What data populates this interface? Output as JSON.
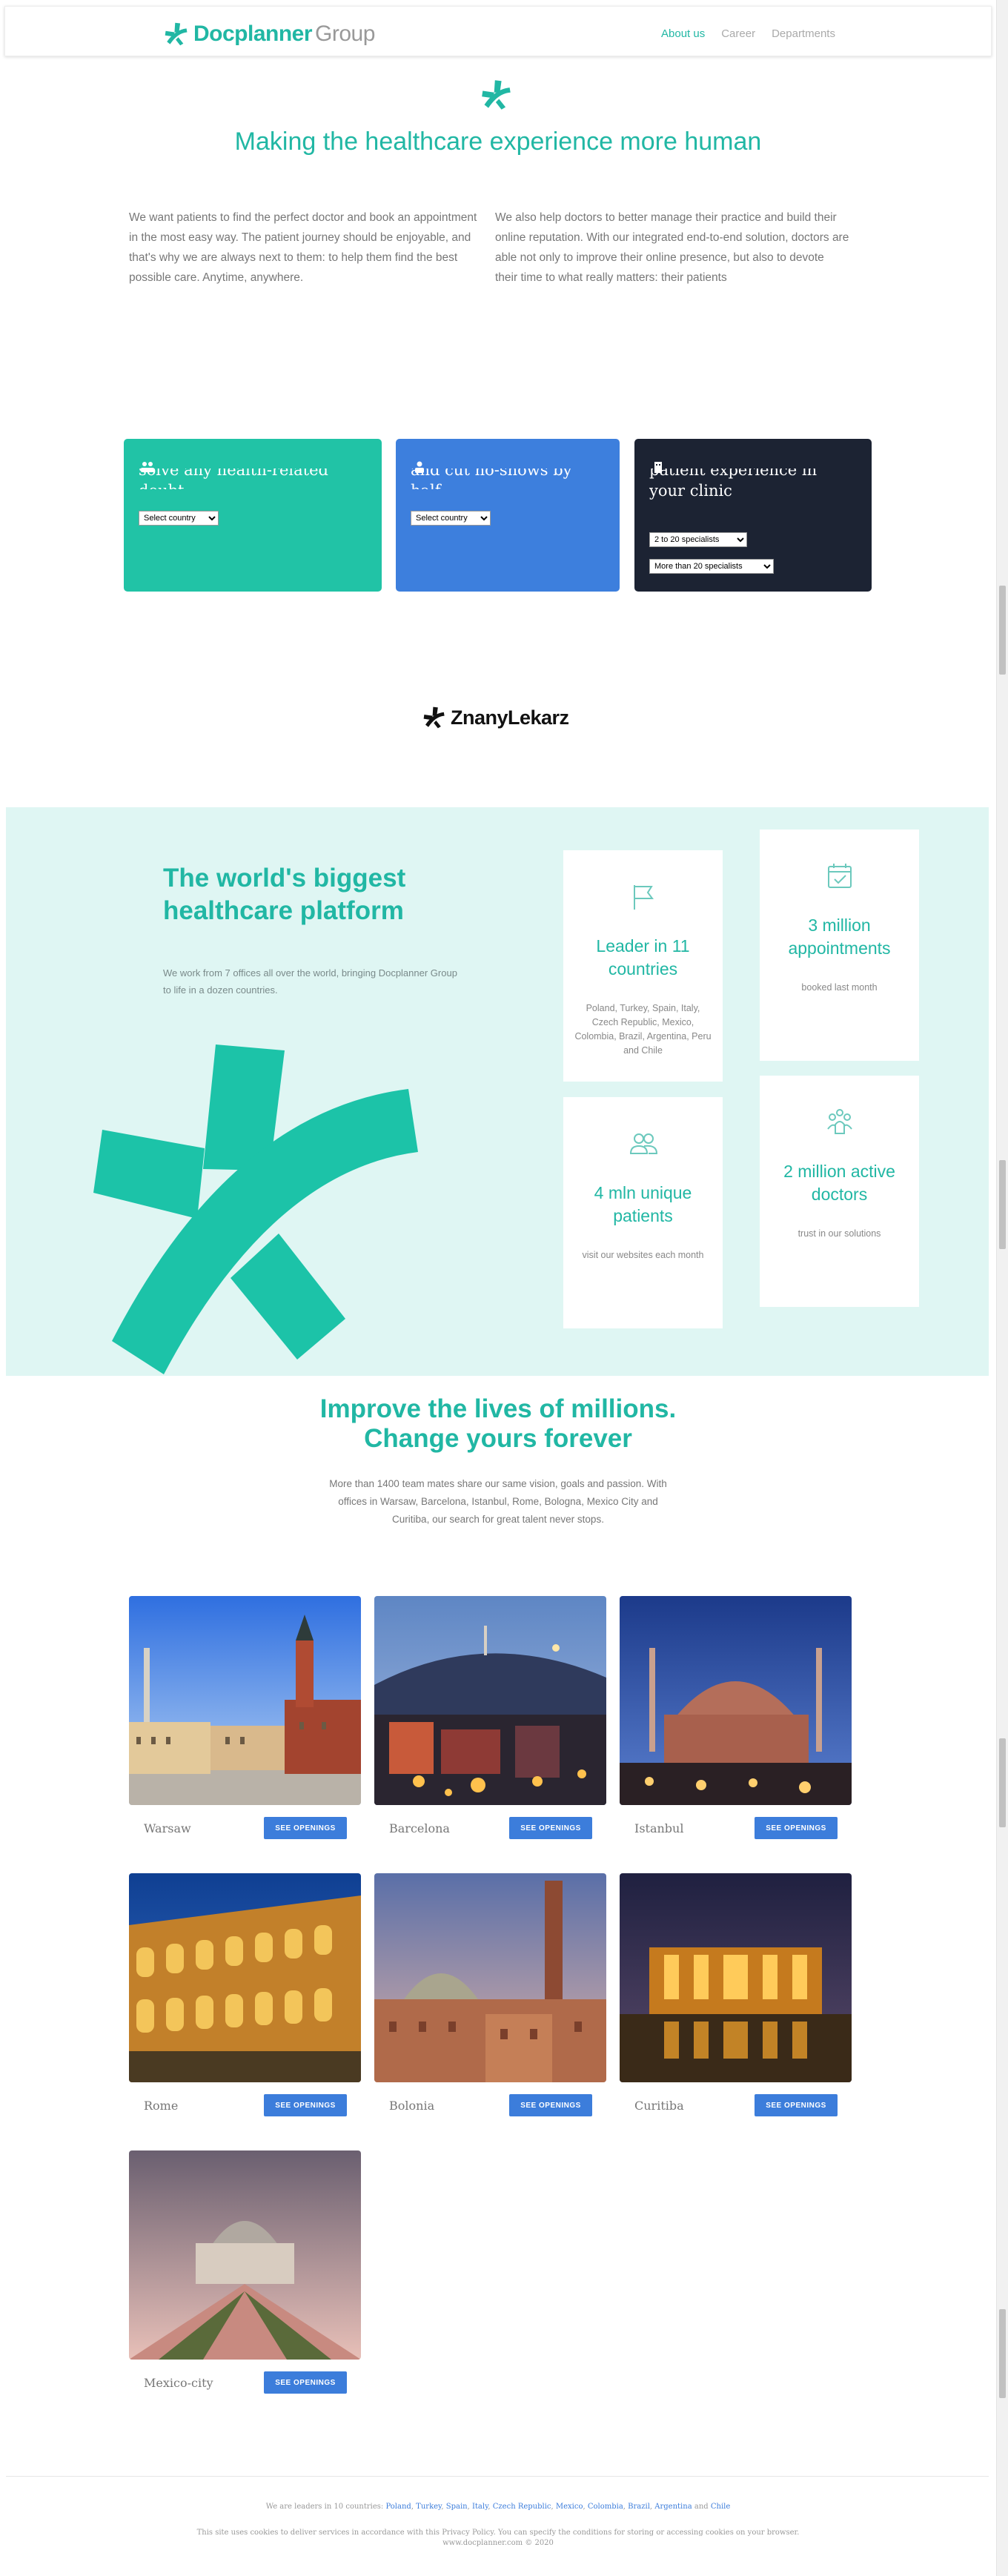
{
  "header": {
    "logo_brand": "Docplanner",
    "logo_suffix": "Group",
    "nav": [
      {
        "label": "About us",
        "active": true
      },
      {
        "label": "Career",
        "active": false
      },
      {
        "label": "Departments",
        "active": false
      }
    ]
  },
  "hero": {
    "title": "Making the healthcare experience more human",
    "left_text": "We want patients to find the perfect doctor and book an appointment in the most easy way. The patient journey should be enjoyable, and that's why we are always next to them: to help them find the best possible care. Anytime, anywhere.",
    "right_text": "We also help doctors to better manage their practice and build their online reputation. With our integrated end-to-end solution, doctors are able not only to improve their online presence, but also to devote their time to what really matters: their patients"
  },
  "cards": [
    {
      "text": "solve any health-related doubt",
      "color": "#21c3a6",
      "select": "Select country"
    },
    {
      "text": "and cut no-shows by half",
      "color": "#3d7fdd",
      "select": "Select country"
    },
    {
      "text": "patient experience in your clinic",
      "color": "#1c2333",
      "select": "2 to 20 specialists",
      "select2": "More than 20 specialists"
    }
  ],
  "partner_logo": "ZnanyLekarz",
  "stats": {
    "title": "The world's biggest healthcare platform",
    "subtitle": "We work from 7 offices all over the world, bringing Docplanner Group to life in a dozen countries.",
    "items": [
      {
        "icon": "flag-icon",
        "value": "Leader in 11 countries",
        "desc": "Poland, Turkey, Spain, Italy, Czech Republic, Mexico, Colombia, Brazil, Argentina, Peru and Chile"
      },
      {
        "icon": "calendar-check-icon",
        "value": "3 million appointments",
        "desc": "booked last month"
      },
      {
        "icon": "users-icon",
        "value": "4 mln unique patients",
        "desc": "visit our websites each month"
      },
      {
        "icon": "doctors-icon",
        "value": "2 million active doctors",
        "desc": "trust in our solutions"
      }
    ]
  },
  "careers": {
    "title_line1": "Improve the lives of millions.",
    "title_line2": "Change yours forever",
    "subtitle": "More than 1400 team mates share our same vision, goals and passion. With offices in Warsaw, Barcelona, Istanbul, Rome, Bologna, Mexico City and Curitiba, our search for great talent never stops.",
    "button_label": "SEE OPENINGS",
    "cities": [
      "Warsaw",
      "Barcelona",
      "Istanbul",
      "Rome",
      "Bolonia",
      "Curitiba",
      "Mexico-city"
    ]
  },
  "footer": {
    "leaders_prefix": "We are leaders in 10 countries:",
    "countries": [
      "Poland",
      "Turkey",
      "Spain",
      "Italy",
      "Czech Republic",
      "Mexico",
      "Colombia",
      "Brazil",
      "Argentina"
    ],
    "and_word": "and",
    "last_country": "Chile",
    "cookies": "This site uses cookies to deliver services in accordance with this Privacy Policy. You can specify the conditions for storing or accessing cookies on your browser.",
    "copyright": "www.docplanner.com © 2020"
  }
}
